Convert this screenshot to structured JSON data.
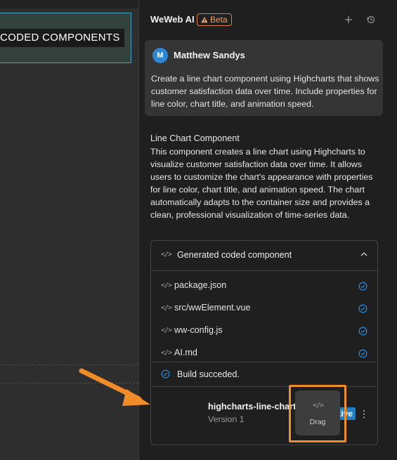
{
  "canvas": {
    "heading": "CODED COMPONENTS"
  },
  "panel": {
    "title": "WeWeb AI",
    "beta_label": "Beta",
    "add_icon": "plus-icon",
    "history_icon": "history-icon"
  },
  "user_message": {
    "avatar_initial": "M",
    "name": "Matthew Sandys",
    "text": "Create a line chart component using Highcharts that shows customer satisfaction data over time. Include properties for line color, chart title, and animation speed."
  },
  "ai_response": {
    "title": "Line Chart Component",
    "body": "This component creates a line chart using Highcharts to visualize customer satisfaction data over time. It allows users to customize the chart's appearance with properties for line color, chart title, and animation speed. The chart automatically adapts to the container size and provides a clean, professional visualization of time-series data."
  },
  "generated": {
    "header_label": "Generated coded component",
    "files": [
      {
        "name": "package.json",
        "status_icon": "check-circle-icon"
      },
      {
        "name": "src/wwElement.vue",
        "status_icon": "check-circle-icon"
      },
      {
        "name": "ww-config.js",
        "status_icon": "check-circle-icon"
      },
      {
        "name": "AI.md",
        "status_icon": "check-circle-icon"
      }
    ],
    "build_status": "Build succeded.",
    "component": {
      "name": "highcharts-line-chart",
      "version": "Version 1",
      "status_badge": "Active",
      "drag_label": "Drag"
    }
  },
  "colors": {
    "accent_blue": "#2e87d1",
    "beta_orange": "#e07a3a",
    "highlight_orange": "#f28c28",
    "active_badge": "#1f80c9"
  }
}
